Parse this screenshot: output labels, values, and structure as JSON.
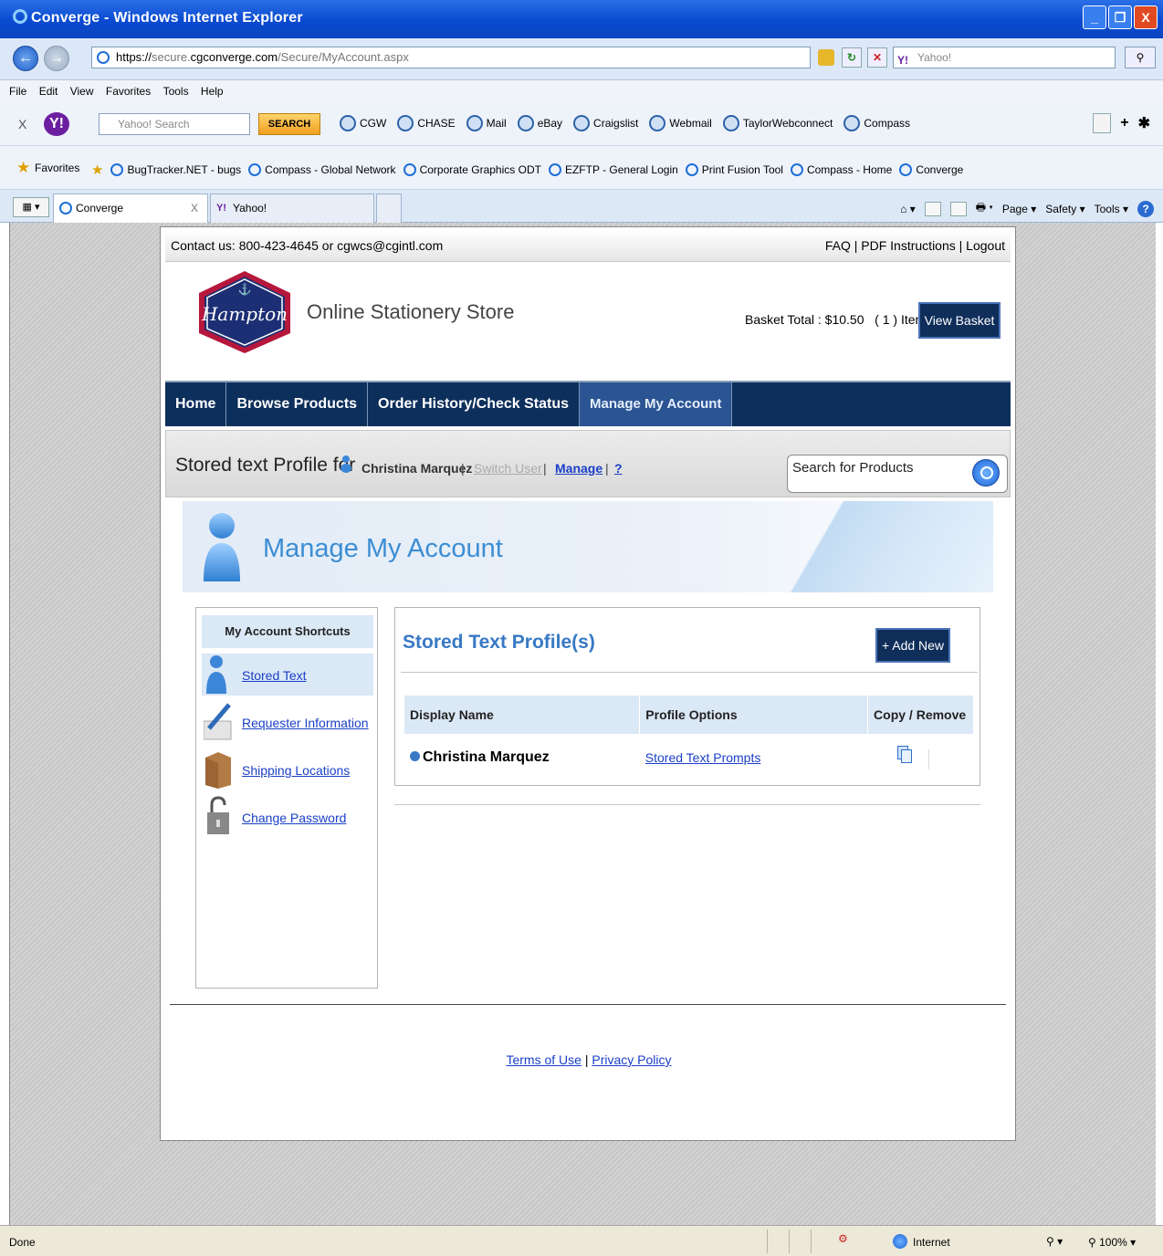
{
  "browser": {
    "title": "Converge - Windows Internet Explorer",
    "url_scheme": "https://",
    "url_host_prefix": "secure.",
    "url_host": "cgconverge.com",
    "url_path": "/Secure/MyAccount.aspx",
    "search_placeholder": "Yahoo!",
    "menu": [
      "File",
      "Edit",
      "View",
      "Favorites",
      "Tools",
      "Help"
    ],
    "yahoo_toolbar": {
      "close": "X",
      "search_placeholder": "Yahoo! Search",
      "search_button": "SEARCH",
      "items": [
        "CGW",
        "CHASE",
        "Mail",
        "eBay",
        "Craigslist",
        "Webmail",
        "TaylorWebconnect",
        "Compass"
      ]
    },
    "favorites": {
      "label": "Favorites",
      "items": [
        "BugTracker.NET - bugs",
        "Compass - Global Network",
        "Corporate Graphics ODT",
        "EZFTP - General Login",
        "Print Fusion Tool",
        "Compass - Home",
        "Converge"
      ]
    },
    "tabs": [
      {
        "label": "Converge",
        "close": "X"
      },
      {
        "label": "Yahoo!"
      }
    ],
    "commands": [
      "Page",
      "Safety",
      "Tools"
    ],
    "status": {
      "left": "Done",
      "zone": "Internet",
      "zoom": "100%"
    }
  },
  "site": {
    "contact": "Contact us: 800-423-4645 or cgwcs@cgintl.com",
    "top_links": "FAQ | PDF Instructions | Logout",
    "logo_text": "Hampton",
    "store_name": "Online Stationery Store",
    "basket_total": "Basket Total : $10.50   ( 1 ) Items",
    "view_basket": "View Basket",
    "nav": [
      "Home",
      "Browse Products",
      "Order History/Check Status",
      "Manage My Account"
    ],
    "profile_bar": {
      "label": "Stored text Profile for",
      "user": "Christina Marquez",
      "switch_user": "Switch User",
      "manage": "Manage",
      "help": "?"
    },
    "search_placeholder": "Search for Products",
    "banner_title": "Manage My Account",
    "shortcuts": {
      "header": "My Account Shortcuts",
      "items": [
        "Stored Text",
        "Requester Information",
        "Shipping Locations",
        "Change Password"
      ]
    },
    "profiles": {
      "heading": "Stored Text Profile(s)",
      "add_new": "+ Add New",
      "columns": [
        "Display Name",
        "Profile Options",
        "Copy / Remove"
      ],
      "rows": [
        {
          "display_name": "Christina Marquez",
          "option": "Stored Text Prompts"
        }
      ]
    },
    "footer": {
      "terms": "Terms of Use",
      "privacy": "Privacy Policy",
      "sep": "|"
    }
  }
}
